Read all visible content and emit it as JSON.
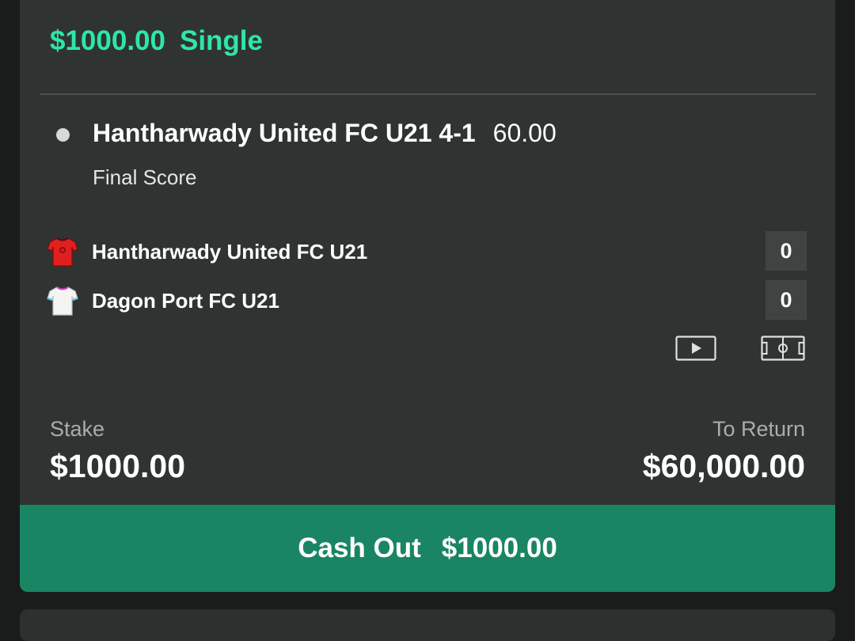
{
  "bet": {
    "amount": "$1000.00",
    "type": "Single"
  },
  "selection": {
    "title": "Hantharwady United FC U21 4-1",
    "odds": "60.00",
    "market": "Final Score"
  },
  "teams": [
    {
      "name": "Hantharwady United FC U21",
      "score": "0",
      "jersey_icon": "red-jersey-icon",
      "jersey_color": "#e0201f"
    },
    {
      "name": "Dagon Port FC U21",
      "score": "0",
      "jersey_icon": "white-jersey-icon",
      "jersey_color": "#f4f4f4"
    }
  ],
  "icons": {
    "video": "play-video-icon",
    "pitch": "pitch-view-icon"
  },
  "stake": {
    "label": "Stake",
    "value": "$1000.00"
  },
  "to_return": {
    "label": "To Return",
    "value": "$60,000.00"
  },
  "cashout": {
    "label": "Cash Out",
    "amount": "$1000.00"
  },
  "colors": {
    "accent": "#2ee6a8",
    "cashout_bg": "#1a8563",
    "card_bg": "#2f3432"
  }
}
